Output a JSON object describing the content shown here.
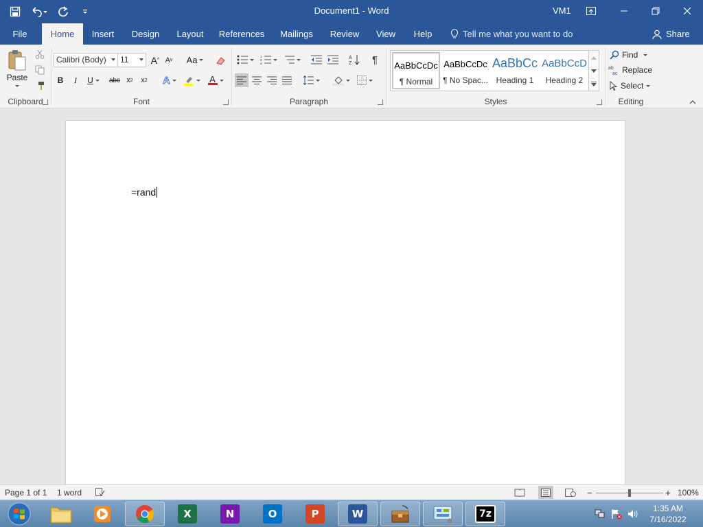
{
  "window": {
    "title": "Document1  -  Word",
    "user": "VM1",
    "accent": "#2b579a"
  },
  "qat": {
    "save_icon": "save-icon",
    "undo_icon": "undo-icon",
    "redo_icon": "redo-icon",
    "customize_icon": "customize-qat-icon"
  },
  "tabs": [
    {
      "label": "File"
    },
    {
      "label": "Home"
    },
    {
      "label": "Insert"
    },
    {
      "label": "Design"
    },
    {
      "label": "Layout"
    },
    {
      "label": "References"
    },
    {
      "label": "Mailings"
    },
    {
      "label": "Review"
    },
    {
      "label": "View"
    },
    {
      "label": "Help"
    }
  ],
  "tell_me": "Tell me what you want to do",
  "share": "Share",
  "ribbon": {
    "clipboard": {
      "label": "Clipboard",
      "paste": "Paste"
    },
    "font": {
      "label": "Font",
      "family": "Calibri (Body)",
      "size": "11",
      "case_label": "Aa"
    },
    "paragraph": {
      "label": "Paragraph"
    },
    "styles": {
      "label": "Styles",
      "items": [
        {
          "preview": "AaBbCcDc",
          "name": "¶ Normal"
        },
        {
          "preview": "AaBbCcDc",
          "name": "¶ No Spac..."
        },
        {
          "preview": "AaBbCc",
          "name": "Heading 1"
        },
        {
          "preview": "AaBbCcD",
          "name": "Heading 2"
        }
      ]
    },
    "editing": {
      "label": "Editing",
      "find": "Find",
      "replace": "Replace",
      "select": "Select"
    }
  },
  "document": {
    "text": "=rand"
  },
  "status": {
    "page": "Page 1 of 1",
    "words": "1 word",
    "zoom": "100%",
    "zoom_level": 1.0
  },
  "taskbar": {
    "time": "1:35 AM",
    "date": "7/16/2022"
  }
}
